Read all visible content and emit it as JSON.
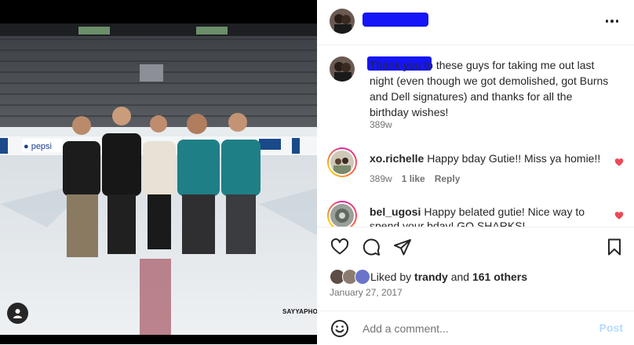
{
  "post": {
    "watermark": "SAYYAPHO",
    "date": "January 27, 2017"
  },
  "header": {
    "more_icon": "more-horizontal-icon"
  },
  "caption": {
    "text": "Thank you to these guys for taking me out last night (even though we got demolished, got Burns and Dell signatures) and thanks for all the birthday wishes!",
    "time": "389w"
  },
  "comments": [
    {
      "username": "xo.richelle",
      "text": "Happy bday Gutie!! Miss ya homie!!",
      "time": "389w",
      "likes": "1 like",
      "reply": "Reply",
      "liked": true
    },
    {
      "username": "bel_ugosi",
      "text": "Happy belated gutie! Nice way to spend your bday! GO SHARKS!",
      "liked": true
    }
  ],
  "actions": {
    "icons": [
      "heart-icon",
      "comment-icon",
      "share-icon",
      "bookmark-icon"
    ]
  },
  "likes": {
    "prefix": "Liked by",
    "user": "trandy",
    "middle": "and",
    "others": "161 others"
  },
  "add_comment": {
    "placeholder": "Add a comment...",
    "post_label": "Post"
  },
  "colors": {
    "accent": "#0095f6",
    "like_red": "#ed4956",
    "redaction": "#1515f5",
    "post_disabled": "#b3dbff"
  }
}
